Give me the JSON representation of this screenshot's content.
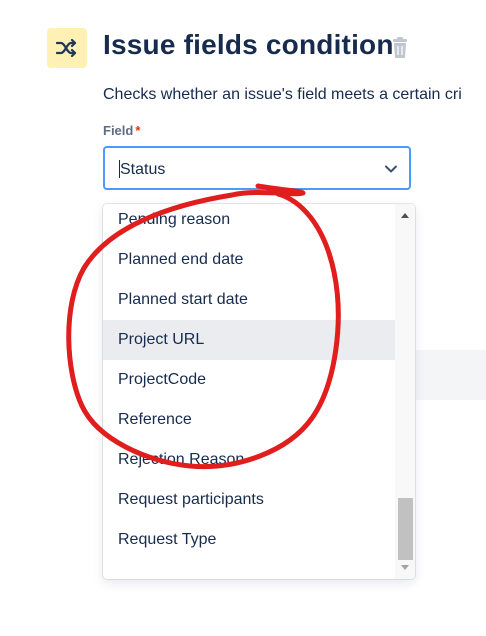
{
  "header": {
    "icon": "shuffle-icon",
    "icon_bg": "#fff0b3",
    "title": "Issue fields condition",
    "delete_icon": "trash-icon"
  },
  "description": "Checks whether an issue's field meets a certain cri",
  "field": {
    "label": "Field",
    "required_mark": "*",
    "value": "Status",
    "dropdown_icon": "chevron-down-icon"
  },
  "dropdown": {
    "options": [
      "Pending reason",
      "Planned end date",
      "Planned start date",
      "Project URL",
      "ProjectCode",
      "Reference",
      "Rejection Reason",
      "Request participants",
      "Request Type"
    ],
    "highlighted": "Project URL"
  },
  "annotation": {
    "shape": "freehand circle",
    "color": "#e01e1e"
  }
}
